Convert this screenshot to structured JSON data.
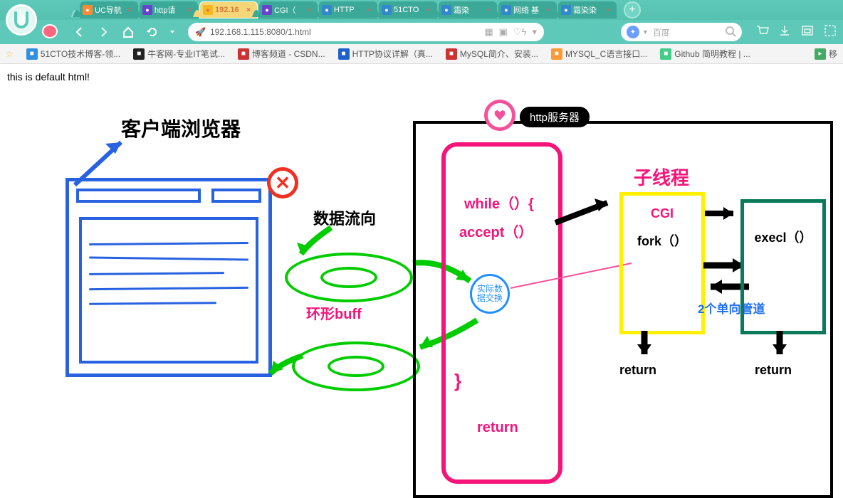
{
  "tabs": [
    {
      "label": "UC导航",
      "icon_bg": "#ff8833"
    },
    {
      "label": "http请",
      "icon_bg": "#6644cc"
    },
    {
      "label": "192.16",
      "icon_bg": "#f5b820",
      "active": true
    },
    {
      "label": "CGI（",
      "icon_bg": "#6644cc"
    },
    {
      "label": "HTTP",
      "icon_bg": "#3388cc"
    },
    {
      "label": "51CTO",
      "icon_bg": "#3388cc"
    },
    {
      "label": "霜染",
      "icon_bg": "#3388cc"
    },
    {
      "label": "网络 基",
      "icon_bg": "#3388cc"
    },
    {
      "label": "霜染染",
      "icon_bg": "#3388cc"
    }
  ],
  "url": "192.168.1.115:8080/1.html",
  "search_placeholder": "百度",
  "bookmarks": [
    {
      "label": "51CTO技术博客-领...",
      "bg": "#3090e0"
    },
    {
      "label": "牛客网-专业IT笔试...",
      "bg": "#222"
    },
    {
      "label": "博客频道 - CSDN...",
      "bg": "#cc3333"
    },
    {
      "label": "HTTP协议详解（真...",
      "bg": "#2060cc"
    },
    {
      "label": "MySQL简介、安装...",
      "bg": "#cc3333"
    },
    {
      "label": "MYSQL_C语言接口...",
      "bg": "#ff9933"
    },
    {
      "label": "Github 简明教程 | ...",
      "bg": "#44cc88"
    }
  ],
  "bookmarks_more": "移",
  "page_text": "this is default html!",
  "diagram": {
    "client_title": "客户端浏览器",
    "server_title": "http服务器",
    "data_flow": "数据流向",
    "ring_buff": "环形buff",
    "exchange": "实际数\n据交换",
    "while": "while（）{",
    "accept": "accept（）",
    "close_brace": "}",
    "return": "return",
    "child_thread": "子线程",
    "cgi": "CGI",
    "fork": "fork（）",
    "execl": "execl（）",
    "pipes": "2个单向管道",
    "return1": "return",
    "return2": "return"
  }
}
